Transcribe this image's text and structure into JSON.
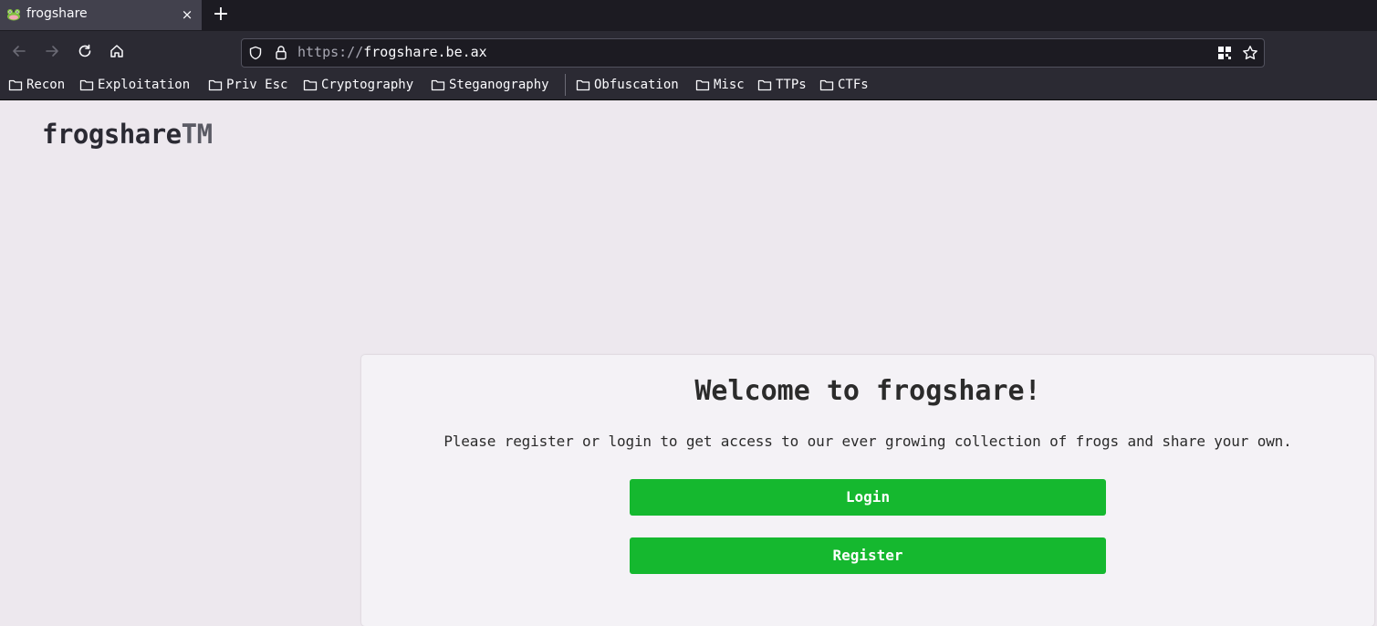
{
  "browser": {
    "tab": {
      "title": "frogshare",
      "favicon": "frog-icon",
      "close_label": "×"
    },
    "new_tab_label": "+",
    "url": {
      "scheme": "https://",
      "host": "frogshare.be.ax"
    },
    "nav_icons": [
      "back-arrow-icon",
      "forward-arrow-icon",
      "reload-icon",
      "home-icon"
    ],
    "urlbar_icons": [
      "shield-icon",
      "lock-icon",
      "qr-code-icon",
      "star-icon"
    ],
    "bookmarks": [
      {
        "label": "Recon"
      },
      {
        "label": "Exploitation"
      },
      {
        "label": "Priv Esc"
      },
      {
        "label": "Cryptography"
      },
      {
        "label": "Steganography"
      },
      {
        "label": "Obfuscation"
      },
      {
        "label": "Misc"
      },
      {
        "label": "TTPs"
      },
      {
        "label": "CTFs"
      }
    ]
  },
  "page": {
    "logo": {
      "name": "frogshare",
      "tm": "TM"
    },
    "welcome_title": "Welcome to frogshare!",
    "intro_text": "Please register or login to get access to our ever growing collection of frogs and share your own.",
    "login_label": "Login",
    "register_label": "Register",
    "accent_color": "#15b82f"
  }
}
